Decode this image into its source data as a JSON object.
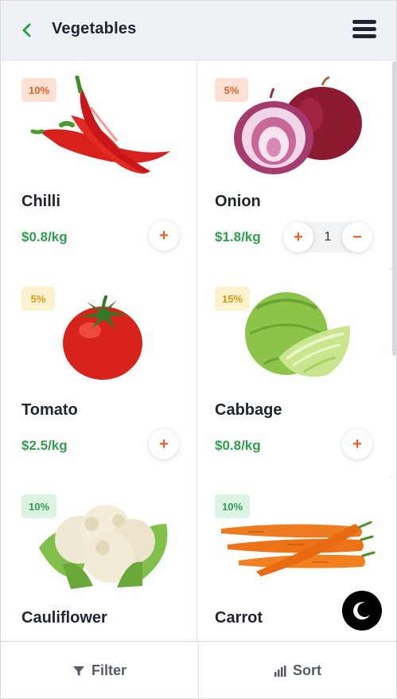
{
  "header": {
    "title": "Vegetables",
    "back_icon": "chevron-left-icon",
    "menu_icon": "hamburger-menu-icon"
  },
  "products": [
    {
      "name": "Chilli",
      "price": "$0.8/kg",
      "discount": "10%",
      "badge_color": "orange",
      "image": "chilli-image",
      "quantity": null
    },
    {
      "name": "Onion",
      "price": "$1.8/kg",
      "discount": "5%",
      "badge_color": "orange",
      "image": "onion-image",
      "quantity": "1"
    },
    {
      "name": "Tomato",
      "price": "$2.5/kg",
      "discount": "5%",
      "badge_color": "yellow",
      "image": "tomato-image",
      "quantity": null
    },
    {
      "name": "Cabbage",
      "price": "$0.8/kg",
      "discount": "15%",
      "badge_color": "yellow",
      "image": "cabbage-image",
      "quantity": null
    },
    {
      "name": "Cauliflower",
      "price": "",
      "discount": "10%",
      "badge_color": "green",
      "image": "cauliflower-image",
      "quantity": null
    },
    {
      "name": "Carrot",
      "price": "",
      "discount": "10%",
      "badge_color": "green",
      "image": "carrot-image",
      "quantity": null
    }
  ],
  "controls": {
    "add_symbol": "+",
    "remove_symbol": "−"
  },
  "bottom_bar": {
    "filter_label": "Filter",
    "sort_label": "Sort",
    "filter_icon": "funnel-icon",
    "sort_icon": "bar-chart-icon"
  },
  "colors": {
    "accent_green": "#2f9e4f",
    "accent_orange": "#e5612a",
    "header_bg": "#eef1f6"
  },
  "dark_mode_icon": "moon-icon"
}
